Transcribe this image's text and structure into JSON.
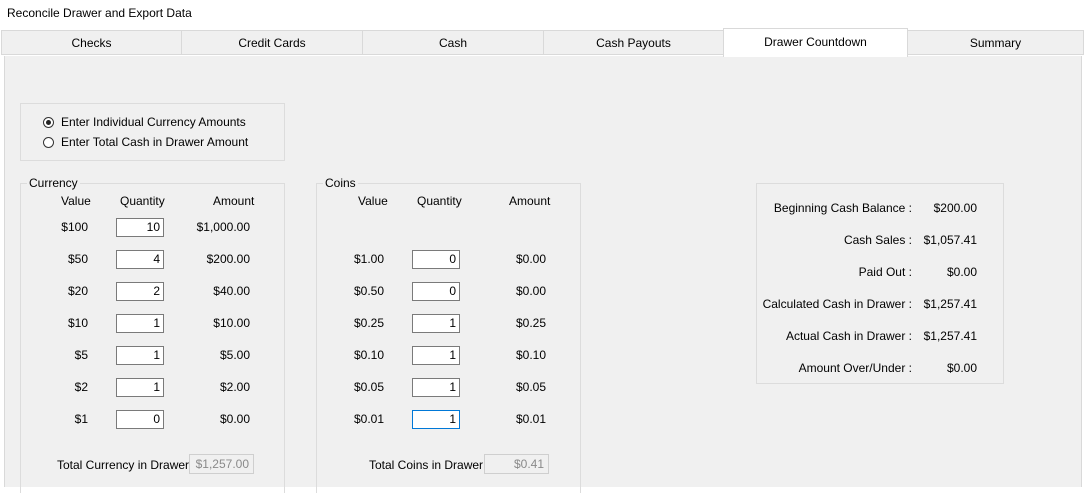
{
  "window": {
    "title": "Reconcile Drawer and Export Data"
  },
  "tabs": [
    {
      "label": "Checks"
    },
    {
      "label": "Credit Cards"
    },
    {
      "label": "Cash"
    },
    {
      "label": "Cash Payouts"
    },
    {
      "label": "Drawer Countdown"
    },
    {
      "label": "Summary"
    }
  ],
  "entry_mode": {
    "options": [
      {
        "label": "Enter Individual Currency Amounts",
        "selected": true
      },
      {
        "label": "Enter Total Cash in Drawer Amount",
        "selected": false
      }
    ]
  },
  "currency": {
    "legend": "Currency",
    "headers": {
      "value": "Value",
      "quantity": "Quantity",
      "amount": "Amount"
    },
    "rows": [
      {
        "value": "$100",
        "quantity": "10",
        "amount": "$1,000.00"
      },
      {
        "value": "$50",
        "quantity": "4",
        "amount": "$200.00"
      },
      {
        "value": "$20",
        "quantity": "2",
        "amount": "$40.00"
      },
      {
        "value": "$10",
        "quantity": "1",
        "amount": "$10.00"
      },
      {
        "value": "$5",
        "quantity": "1",
        "amount": "$5.00"
      },
      {
        "value": "$2",
        "quantity": "1",
        "amount": "$2.00"
      },
      {
        "value": "$1",
        "quantity": "0",
        "amount": "$0.00"
      }
    ],
    "total_label": "Total Currency in Drawer:",
    "total_value": "$1,257.00"
  },
  "coins": {
    "legend": "Coins",
    "headers": {
      "value": "Value",
      "quantity": "Quantity",
      "amount": "Amount"
    },
    "rows": [
      {
        "value": "$1.00",
        "quantity": "0",
        "amount": "$0.00"
      },
      {
        "value": "$0.50",
        "quantity": "0",
        "amount": "$0.00"
      },
      {
        "value": "$0.25",
        "quantity": "1",
        "amount": "$0.25"
      },
      {
        "value": "$0.10",
        "quantity": "1",
        "amount": "$0.10"
      },
      {
        "value": "$0.05",
        "quantity": "1",
        "amount": "$0.05"
      },
      {
        "value": "$0.01",
        "quantity": "1",
        "amount": "$0.01"
      }
    ],
    "total_label": "Total Coins in Drawer:",
    "total_value": "$0.41"
  },
  "summary": {
    "rows": [
      {
        "label": "Beginning Cash Balance :",
        "value": "$200.00"
      },
      {
        "label": "Cash Sales :",
        "value": "$1,057.41"
      },
      {
        "label": "Paid Out :",
        "value": "$0.00"
      },
      {
        "label": "Calculated Cash in Drawer :",
        "value": "$1,257.41"
      },
      {
        "label": "Actual Cash in Drawer :",
        "value": "$1,257.41"
      },
      {
        "label": "Amount Over/Under :",
        "value": "$0.00"
      }
    ]
  }
}
